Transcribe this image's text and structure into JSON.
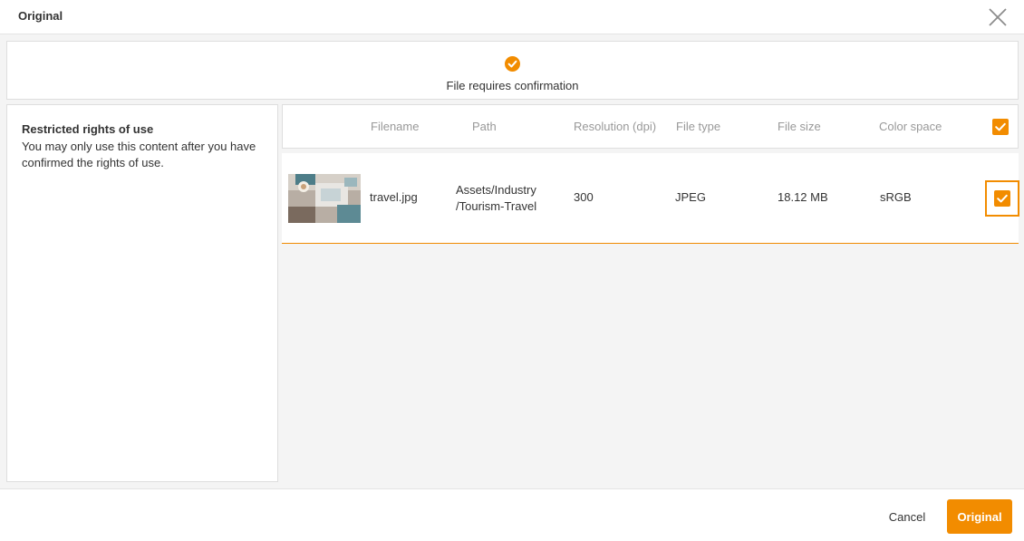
{
  "dialog": {
    "title": "Original"
  },
  "banner": {
    "message": "File requires confirmation",
    "icon": "check-circle-icon",
    "icon_color": "#f28c00"
  },
  "rights": {
    "title": "Restricted rights of use",
    "description": "You may only use this content after you have confirmed the rights of use."
  },
  "table": {
    "columns": [
      "Filename",
      "Path",
      "Resolution (dpi)",
      "File type",
      "File size",
      "Color space"
    ],
    "select_all_checked": true,
    "rows": [
      {
        "thumbnail": "travel-photo-thumbnail",
        "filename": "travel.jpg",
        "path_line1": "Assets/Industry",
        "path_line2": "/Tourism-Travel",
        "resolution": "300",
        "file_type": "JPEG",
        "file_size": "18.12 MB",
        "color_space": "sRGB",
        "checked": true
      }
    ]
  },
  "footer": {
    "cancel_label": "Cancel",
    "confirm_label": "Original"
  },
  "colors": {
    "accent": "#f28c00",
    "header_text": "#999999",
    "body_background": "#f4f4f4"
  }
}
